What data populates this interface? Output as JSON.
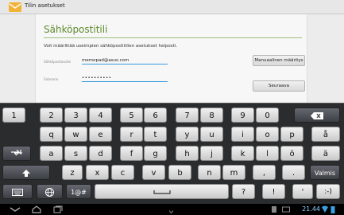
{
  "topbar": {
    "title": "Tilin asetukset",
    "icon": "email-app-icon"
  },
  "form": {
    "heading": "Sähköpostitili",
    "description": "Voit määrittää useimpien sähköpostitilien asetukset helposti.",
    "email_label": "Sähköpostiosoite",
    "email_value": "memopad@asus.com",
    "password_label": "Salasana",
    "password_value": "••••••••••",
    "manual_button": "Manuaalinen määritys",
    "next_button": "Seuraava"
  },
  "keyboard": {
    "row1": [
      "1",
      "2",
      "3",
      "4",
      "5",
      "6",
      "7",
      "8",
      "9",
      "0"
    ],
    "row2": [
      "q",
      "w",
      "e",
      "r",
      "t",
      "y",
      "u",
      "i",
      "o",
      "p",
      "å"
    ],
    "row3": [
      "a",
      "s",
      "d",
      "f",
      "g",
      "h",
      "j",
      "k",
      "l",
      "ö",
      "ä"
    ],
    "row4": [
      "z",
      "x",
      "c",
      "v",
      "b",
      "n",
      "m",
      ",",
      "."
    ],
    "done_label": "Valmis",
    "symbols_label": "1@#",
    "question": "?",
    "exclaim": "!",
    "apostrophe": "'",
    "smiley": ":-)"
  },
  "status": {
    "time": "21.44"
  },
  "colors": {
    "accent": "#5f8a2c",
    "field_underline": "#3a9ad9",
    "keyboard_bg": "#2a2c2e"
  }
}
